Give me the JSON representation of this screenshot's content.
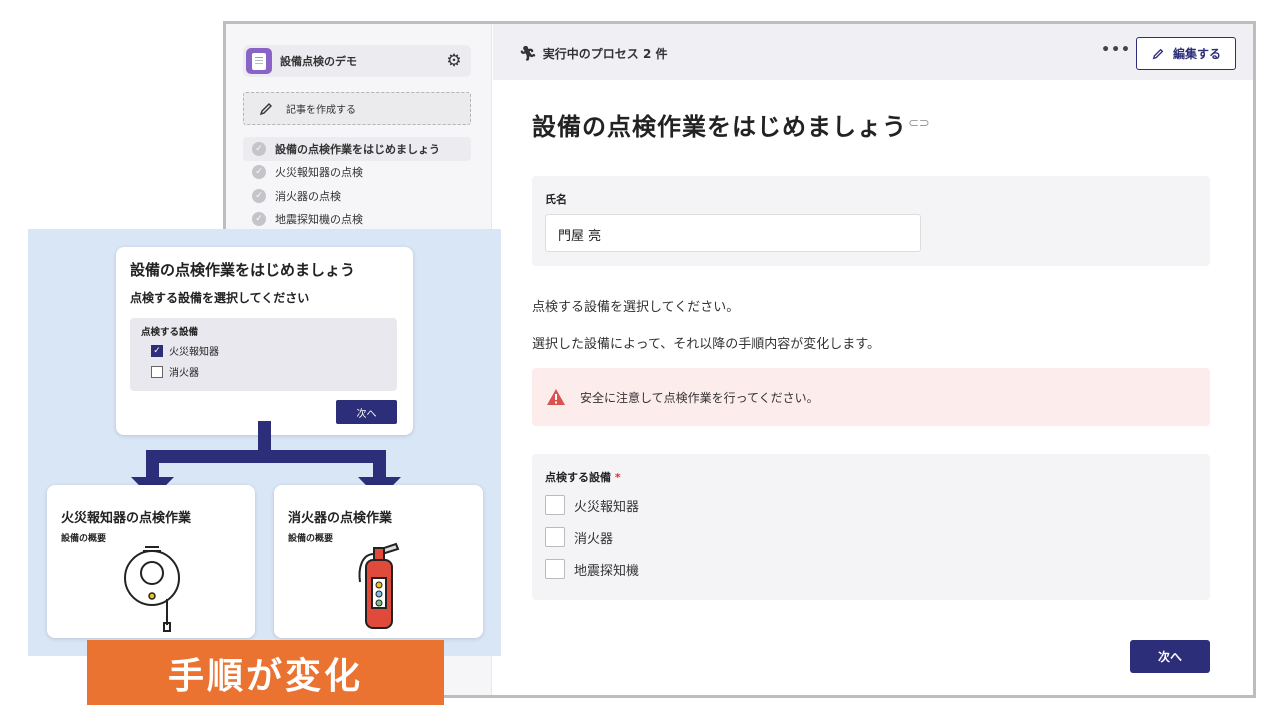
{
  "sidebar": {
    "app_name": "設備点検のデモ",
    "create_label": "記事を作成する",
    "steps": [
      {
        "label": "設備の点検作業をはじめましょう"
      },
      {
        "label": "火災報知器の点検"
      },
      {
        "label": "消火器の点検"
      },
      {
        "label": "地震探知機の点検"
      }
    ]
  },
  "topbar": {
    "process_label": "実行中のプロセス 2 件",
    "more_label": "•••",
    "edit_label": "編集する"
  },
  "main": {
    "title": "設備の点検作業をはじめましょう",
    "name_label": "氏名",
    "name_value": "門屋 亮",
    "para1": "点検する設備を選択してください。",
    "para2": "選択した設備によって、それ以降の手順内容が変化します。",
    "alert_text": "安全に注意して点検作業を行ってください。",
    "equip_label": "点検する設備",
    "required_mark": "*",
    "options": [
      "火災報知器",
      "消火器",
      "地震探知機"
    ],
    "next_label": "次へ"
  },
  "overlay": {
    "top_title": "設備の点検作業をはじめましょう",
    "top_sub": "点検する設備を選択してください",
    "panel_label": "点検する設備",
    "options": [
      {
        "label": "火災報知器",
        "checked": true
      },
      {
        "label": "消火器",
        "checked": false
      }
    ],
    "next_label": "次へ",
    "left_title": "火災報知器の点検作業",
    "left_sub": "設備の概要",
    "right_title": "消火器の点検作業",
    "right_sub": "設備の概要",
    "banner": "手順が変化"
  },
  "colors": {
    "accent": "#2d2e7a",
    "banner": "#ea7331",
    "overlay_bg": "#d9e6f6",
    "alert_bg": "#fdecec",
    "warn": "#d9534f"
  }
}
